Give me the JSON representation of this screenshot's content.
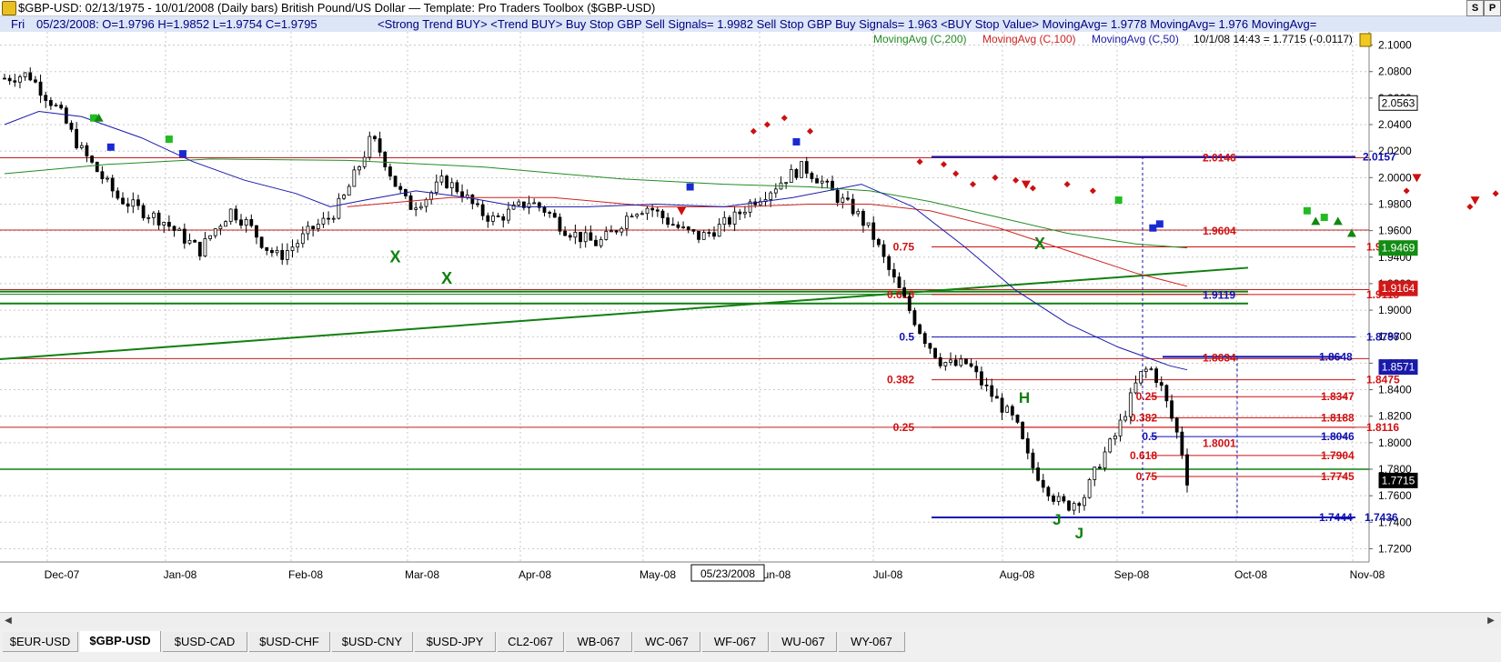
{
  "window": {
    "title": "$GBP-USD:  02/13/1975 - 10/01/2008  (Daily bars)   British Pound/US Dollar  —  Template: Pro Traders Toolbox ($GBP-USD)",
    "btn_s": "S",
    "btn_p": "P"
  },
  "infobar": {
    "day": "Fri",
    "ohlc": "05/23/2008:  O=1.9796  H=1.9852  L=1.9754  C=1.9795",
    "signals": "<Strong Trend BUY>  <Trend BUY>  Buy Stop GBP Sell Signals= 1.9982  Sell Stop GBP Buy Signals= 1.963  <BUY Stop Value>  MovingAvg= 1.9778  MovingAvg= 1.976  MovingAvg="
  },
  "legend": {
    "ma200": "MovingAvg (C,200)",
    "ma100": "MovingAvg (C,100)",
    "ma50": "MovingAvg (C,50)",
    "last_quote": "10/1/08 14:43 = 1.7715 (-0.0117)"
  },
  "colors": {
    "ma200": "#228b22",
    "ma100": "#cc2222",
    "ma50": "#1a1aaa",
    "fib_red": "#d01010",
    "fib_blue": "#1010b0",
    "trend_green": "#108010",
    "grid": "#c8c8c8"
  },
  "chart_data": {
    "type": "candlestick",
    "y_ticks": [
      "2.1000",
      "2.0800",
      "2.0600",
      "2.0400",
      "2.0200",
      "2.0000",
      "1.9800",
      "1.9600",
      "1.9400",
      "1.9200",
      "1.9000",
      "1.8800",
      "1.8600",
      "1.8400",
      "1.8200",
      "1.8000",
      "1.7800",
      "1.7600",
      "1.7400",
      "1.7200"
    ],
    "ylim": [
      1.71,
      2.11
    ],
    "x_months": [
      "Dec-07",
      "Jan-08",
      "Feb-08",
      "Mar-08",
      "Apr-08",
      "May-08",
      "Jun-08",
      "Jul-08",
      "Aug-08",
      "Sep-08",
      "Oct-08",
      "Nov-08"
    ],
    "cursor_date": "05/23/2008",
    "close_path": [
      [
        0,
        2.075
      ],
      [
        14,
        2.078
      ],
      [
        22,
        2.065
      ],
      [
        32,
        2.05
      ],
      [
        44,
        2.022
      ],
      [
        54,
        2.005
      ],
      [
        66,
        1.985
      ],
      [
        80,
        1.975
      ],
      [
        92,
        1.968
      ],
      [
        104,
        1.955
      ],
      [
        114,
        1.945
      ],
      [
        122,
        1.96
      ],
      [
        132,
        1.975
      ],
      [
        142,
        1.965
      ],
      [
        152,
        1.948
      ],
      [
        160,
        1.94
      ],
      [
        170,
        1.95
      ],
      [
        180,
        1.962
      ],
      [
        190,
        1.97
      ],
      [
        198,
        1.985
      ],
      [
        208,
        2.012
      ],
      [
        214,
        2.03
      ],
      [
        220,
        2.018
      ],
      [
        228,
        1.995
      ],
      [
        236,
        1.978
      ],
      [
        246,
        1.985
      ],
      [
        256,
        1.998
      ],
      [
        266,
        1.99
      ],
      [
        276,
        1.975
      ],
      [
        286,
        1.968
      ],
      [
        296,
        1.975
      ],
      [
        306,
        1.982
      ],
      [
        316,
        1.975
      ],
      [
        326,
        1.962
      ],
      [
        336,
        1.955
      ],
      [
        346,
        1.95
      ],
      [
        356,
        1.96
      ],
      [
        366,
        1.975
      ],
      [
        376,
        1.978
      ],
      [
        386,
        1.968
      ],
      [
        396,
        1.96
      ],
      [
        406,
        1.955
      ],
      [
        416,
        1.962
      ],
      [
        426,
        1.97
      ],
      [
        436,
        1.982
      ],
      [
        446,
        1.99
      ],
      [
        456,
        2.0
      ],
      [
        466,
        2.008
      ],
      [
        476,
        1.998
      ],
      [
        486,
        1.985
      ],
      [
        496,
        1.975
      ],
      [
        506,
        1.958
      ],
      [
        516,
        1.93
      ],
      [
        526,
        1.905
      ],
      [
        536,
        1.88
      ],
      [
        546,
        1.862
      ],
      [
        554,
        1.858
      ],
      [
        562,
        1.86
      ],
      [
        570,
        1.845
      ],
      [
        580,
        1.83
      ],
      [
        590,
        1.815
      ],
      [
        598,
        1.785
      ],
      [
        606,
        1.77
      ],
      [
        614,
        1.756
      ],
      [
        620,
        1.752
      ],
      [
        630,
        1.76
      ],
      [
        640,
        1.788
      ],
      [
        648,
        1.805
      ],
      [
        656,
        1.83
      ],
      [
        662,
        1.85
      ],
      [
        668,
        1.857
      ],
      [
        674,
        1.845
      ],
      [
        680,
        1.822
      ],
      [
        686,
        1.8
      ],
      [
        690,
        1.772
      ]
    ],
    "moving_averages": [
      {
        "name": "MovingAvg (C,200)",
        "values": [
          [
            0,
            2.003
          ],
          [
            60,
            2.01
          ],
          [
            120,
            2.014
          ],
          [
            200,
            2.013
          ],
          [
            280,
            2.008
          ],
          [
            360,
            1.999
          ],
          [
            420,
            1.995
          ],
          [
            470,
            1.993
          ],
          [
            505,
            1.99
          ],
          [
            540,
            1.982
          ],
          [
            580,
            1.97
          ],
          [
            620,
            1.958
          ],
          [
            660,
            1.95
          ],
          [
            690,
            1.947
          ]
        ]
      },
      {
        "name": "MovingAvg (C,100)",
        "values": [
          [
            200,
            1.978
          ],
          [
            260,
            1.985
          ],
          [
            320,
            1.985
          ],
          [
            380,
            1.978
          ],
          [
            430,
            1.978
          ],
          [
            470,
            1.98
          ],
          [
            505,
            1.98
          ],
          [
            540,
            1.975
          ],
          [
            580,
            1.962
          ],
          [
            620,
            1.945
          ],
          [
            660,
            1.928
          ],
          [
            690,
            1.918
          ]
        ]
      },
      {
        "name": "MovingAvg (C,50)",
        "values": [
          [
            0,
            2.04
          ],
          [
            20,
            2.05
          ],
          [
            45,
            2.046
          ],
          [
            80,
            2.03
          ],
          [
            110,
            2.012
          ],
          [
            140,
            1.998
          ],
          [
            170,
            1.988
          ],
          [
            190,
            1.978
          ],
          [
            210,
            1.983
          ],
          [
            240,
            1.99
          ],
          [
            270,
            1.985
          ],
          [
            300,
            1.978
          ],
          [
            340,
            1.978
          ],
          [
            380,
            1.98
          ],
          [
            420,
            1.978
          ],
          [
            460,
            1.985
          ],
          [
            500,
            1.995
          ],
          [
            530,
            1.978
          ],
          [
            560,
            1.948
          ],
          [
            590,
            1.915
          ],
          [
            620,
            1.89
          ],
          [
            650,
            1.872
          ],
          [
            680,
            1.858
          ],
          [
            690,
            1.855
          ]
        ]
      }
    ],
    "red_lines_full": [
      2.015,
      1.9604,
      1.9155,
      1.8634,
      1.8116,
      1.78
    ],
    "fib_levels": [
      {
        "ratio": "0.75",
        "value": "1.9477",
        "price": 1.9477
      },
      {
        "ratio": "0.618",
        "value": "1.9118",
        "price": 1.9118
      },
      {
        "ratio": "0.5",
        "value": "1.8797",
        "price": 1.8797
      },
      {
        "ratio": "0.382",
        "value": "1.8475",
        "price": 1.8475
      },
      {
        "ratio": "0.25",
        "value": "1.8116",
        "price": 1.8116
      }
    ],
    "short_fib": [
      {
        "ratio": "0.25",
        "value": "1.8347",
        "price": 1.8347
      },
      {
        "ratio": "0.382",
        "value": "1.8188",
        "price": 1.8188
      },
      {
        "ratio": "0.5",
        "value": "1.8046",
        "price": 1.8046
      },
      {
        "ratio": "0.618",
        "value": "1.7904",
        "price": 1.7904
      },
      {
        "ratio": "0.75",
        "value": "1.7745",
        "price": 1.7745
      }
    ],
    "blue_levels": [
      {
        "value": "2.0157",
        "price": 2.0157,
        "inner_label": "2.0146"
      },
      {
        "value": "1.8648",
        "price": 1.8648,
        "inner_label": "1.8634"
      },
      {
        "value": "1.7436",
        "price": 1.7436,
        "inner_label": "1.7444"
      }
    ],
    "green_levels": [
      1.914,
      1.905,
      1.78
    ],
    "inner_labels": {
      "l1960": "1.9604",
      "l1911": "1.9119",
      "l1800": "1.8001"
    },
    "axis_boxes": [
      {
        "label": "2.0563",
        "price": 2.0563,
        "style": "plain"
      },
      {
        "label": "1.9469",
        "price": 1.9469,
        "style": "green"
      },
      {
        "label": "1.9164",
        "price": 1.9164,
        "style": "red"
      },
      {
        "label": "1.8571",
        "price": 1.8571,
        "style": "blue"
      },
      {
        "label": "1.7715",
        "price": 1.7715,
        "style": "black"
      }
    ],
    "markers": {
      "x_label": "X",
      "pattern_h": "H",
      "pattern_j": "J"
    }
  },
  "tabs": [
    "$EUR-USD",
    "$GBP-USD",
    "$USD-CAD",
    "$USD-CHF",
    "$USD-CNY",
    "$USD-JPY",
    "CL2-067",
    "WB-067",
    "WC-067",
    "WF-067",
    "WU-067",
    "WY-067"
  ],
  "active_tab": 1
}
